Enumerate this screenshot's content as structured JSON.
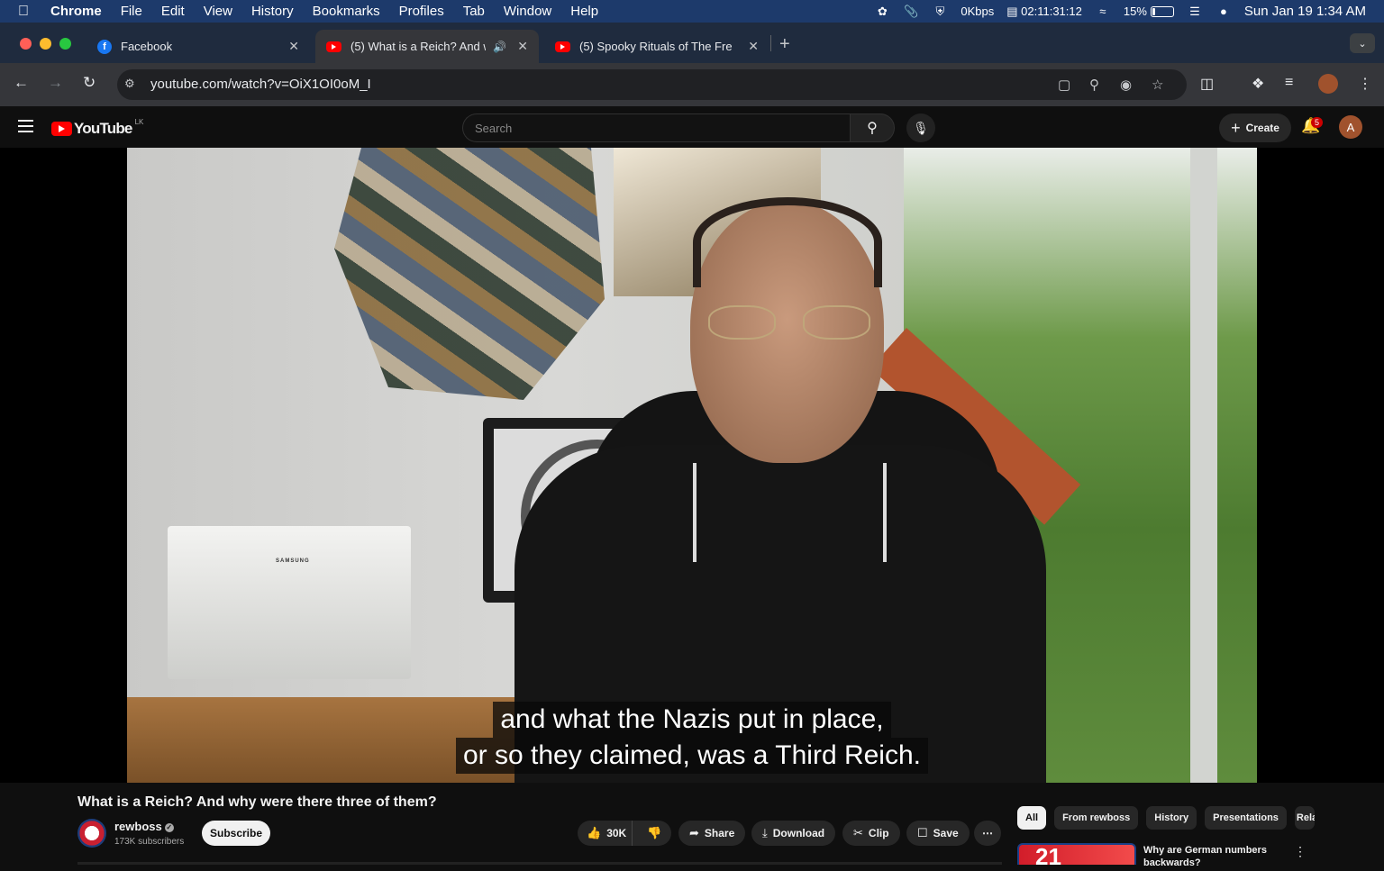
{
  "menubar": {
    "app": "Chrome",
    "items": [
      "File",
      "Edit",
      "View",
      "History",
      "Bookmarks",
      "Profiles",
      "Tab",
      "Window",
      "Help"
    ],
    "network": "0Kbps",
    "timer": "02:11:31:12",
    "battery": "15%",
    "battery_level": 0.15,
    "clock": "Sun Jan 19  1:34 AM"
  },
  "tabs": [
    {
      "label": "Facebook",
      "favicon": "facebook-icon"
    },
    {
      "label": "(5) What is a Reich? And w",
      "favicon": "youtube-icon",
      "audio": true
    },
    {
      "label": "(5) Spooky Rituals of The Fre",
      "favicon": "youtube-icon"
    }
  ],
  "toolbar": {
    "url": "youtube.com/watch?v=OiX1OI0oM_I"
  },
  "yt": {
    "logo": "YouTube",
    "country": "LK",
    "search_placeholder": "Search",
    "create_label": "Create",
    "notifications": "5",
    "avatar_letter": "A"
  },
  "video": {
    "caption_line1": "and what the Nazis put in place,",
    "caption_line2": "or so they claimed, was a Third Reich.",
    "printer_brand": "SAMSUNG",
    "title": "What is a Reich? And why were there three of them?",
    "channel": "rewboss",
    "subscribers": "173K subscribers",
    "subscribe_label": "Subscribe",
    "likes": "30K",
    "share_label": "Share",
    "download_label": "Download",
    "clip_label": "Clip",
    "save_label": "Save"
  },
  "chips": [
    "All",
    "From rewboss",
    "History",
    "Presentations",
    "Rela"
  ],
  "recommendation": {
    "title": "Why are German numbers backwards?",
    "thumb_text": "21"
  },
  "colors": {
    "menubar_bg": "#1d3a6b",
    "tab_active_bg": "#35363a",
    "yt_red": "#ff0000",
    "page_bg": "#0f0f0f"
  }
}
